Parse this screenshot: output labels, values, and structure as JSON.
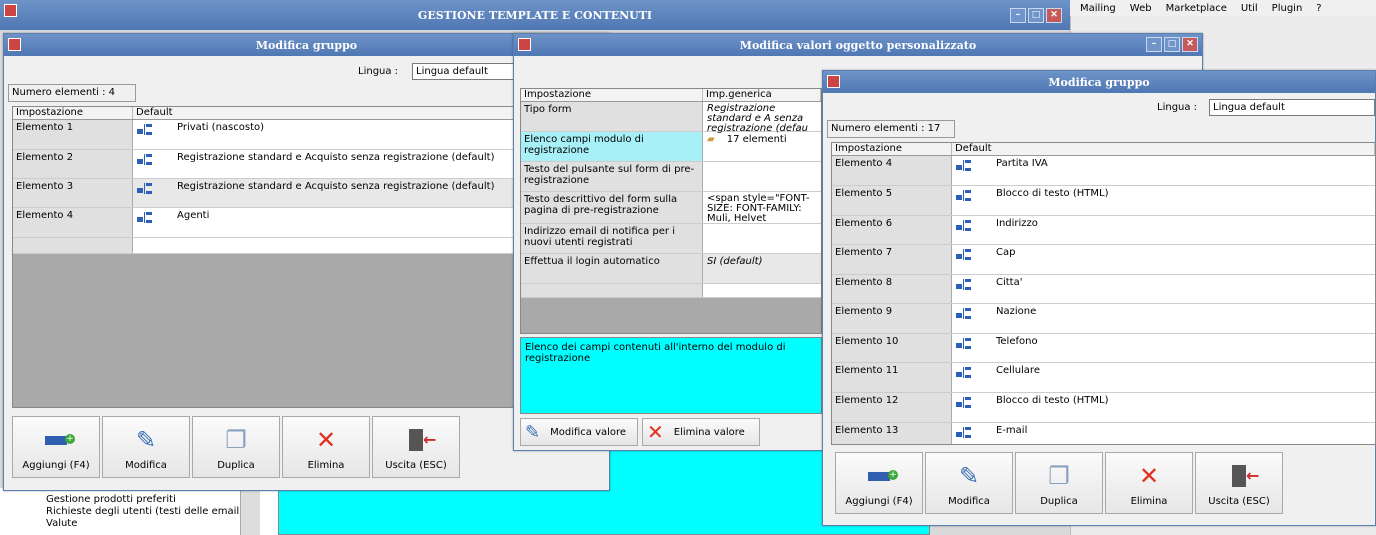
{
  "background": {
    "menubar": [
      "Mailing",
      "Web",
      "Marketplace",
      "Util",
      "Plugin",
      "?"
    ],
    "tree_items": [
      "Gestione prodotti preferiti",
      "Richieste degli utenti (testi delle email)",
      "Valute"
    ]
  },
  "main_window": {
    "title": "GESTIONE TEMPLATE E CONTENUTI"
  },
  "group_left": {
    "title": "Modifica gruppo",
    "lingua_label": "Lingua :",
    "lingua_value": "Lingua default",
    "count": "Numero elementi : 4",
    "col_setting": "Impostazione",
    "col_default": "Default",
    "rows": [
      {
        "name": "Elemento 1",
        "value": "Privati (nascosto)"
      },
      {
        "name": "Elemento 2",
        "value": "Registrazione standard e Acquisto senza registrazione (default)"
      },
      {
        "name": "Elemento 3",
        "value": "Registrazione standard e Acquisto senza registrazione (default)"
      },
      {
        "name": "Elemento 4",
        "value": "Agenti"
      }
    ],
    "buttons": [
      "Aggiungi (F4)",
      "Modifica",
      "Duplica",
      "Elimina",
      "Uscita (ESC)"
    ]
  },
  "custom_obj": {
    "title": "Modifica valori oggetto personalizzato",
    "col_setting": "Impostazione",
    "col_generic": "Imp.generica",
    "rows": [
      {
        "name": "Tipo form",
        "value": "Registrazione standard e A senza registrazione (defau"
      },
      {
        "name": "Elenco campi modulo di registrazione",
        "value": "17 elementi"
      },
      {
        "name": "Testo del pulsante sul form di pre-registrazione",
        "value": ""
      },
      {
        "name": "Testo descrittivo del form sulla pagina di pre-registrazione",
        "value": "<span style=\"FONT-SIZE: FONT-FAMILY: Muli, Helvet"
      },
      {
        "name": "Indirizzo email di notifica per i nuovi utenti registrati",
        "value": ""
      },
      {
        "name": "Effettua il login automatico",
        "value": "SI (default)"
      }
    ],
    "description": "Elenco dei campi contenuti all'interno del modulo di registrazione",
    "btn_edit": "Modifica valore",
    "btn_delete": "Elimina valore"
  },
  "group_right": {
    "title": "Modifica gruppo",
    "lingua_label": "Lingua :",
    "lingua_value": "Lingua default",
    "count": "Numero elementi : 17",
    "col_setting": "Impostazione",
    "col_default": "Default",
    "rows": [
      {
        "name": "Elemento 4",
        "value": "Partita IVA"
      },
      {
        "name": "Elemento 5",
        "value": "Blocco di testo (HTML)"
      },
      {
        "name": "Elemento 6",
        "value": "Indirizzo"
      },
      {
        "name": "Elemento 7",
        "value": "Cap"
      },
      {
        "name": "Elemento 8",
        "value": "Citta'"
      },
      {
        "name": "Elemento 9",
        "value": "Nazione"
      },
      {
        "name": "Elemento 10",
        "value": "Telefono"
      },
      {
        "name": "Elemento 11",
        "value": "Cellulare"
      },
      {
        "name": "Elemento 12",
        "value": "Blocco di testo (HTML)"
      },
      {
        "name": "Elemento 13",
        "value": "E-mail"
      }
    ],
    "buttons": [
      "Aggiungi (F4)",
      "Modifica",
      "Duplica",
      "Elimina",
      "Uscita (ESC)"
    ]
  }
}
